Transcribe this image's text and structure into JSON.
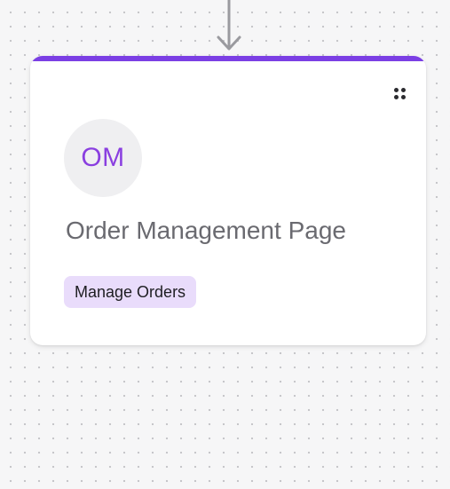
{
  "theme": {
    "accent": "#7b3fe4",
    "avatar_text": "#8a3fe0",
    "tag_bg": "#e9dcfb",
    "edge": "#9a9a9f"
  },
  "node": {
    "avatar_initials": "OM",
    "title": "Order Management Page",
    "tag": "Manage Orders",
    "handle_icon": "drag-handle-icon"
  },
  "edge": {
    "icon": "arrow-down-icon"
  }
}
